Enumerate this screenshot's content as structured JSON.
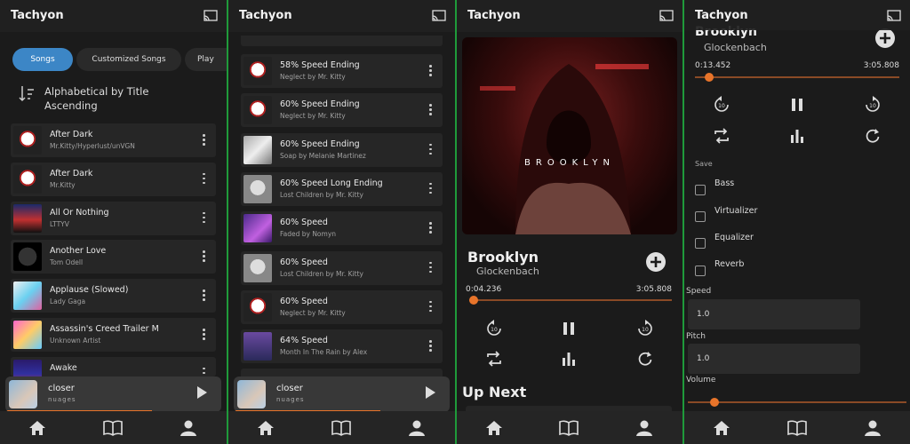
{
  "app": {
    "title": "Tachyon"
  },
  "screen1": {
    "tabs": [
      "Songs",
      "Customized Songs",
      "Play"
    ],
    "sort": {
      "line1": "Alphabetical by Title",
      "line2": "Ascending"
    },
    "songs": [
      {
        "title": "After Dark",
        "subtitle": "Mr.Kitty/Hyperlust/unVGN"
      },
      {
        "title": "After Dark",
        "subtitle": "Mr.Kitty"
      },
      {
        "title": "All Or Nothing",
        "subtitle": "LTTYV"
      },
      {
        "title": "Another Love",
        "subtitle": "Tom Odell"
      },
      {
        "title": "Applause (Slowed)",
        "subtitle": "Lady Gaga"
      },
      {
        "title": "Assassin's Creed Trailer M",
        "subtitle": "Unknown Artist"
      },
      {
        "title": "Awake",
        "subtitle": ""
      }
    ]
  },
  "screen2": {
    "songs": [
      {
        "title": "58% Speed Ending",
        "subtitle": "Neglect by Mr. Kitty"
      },
      {
        "title": "60% Speed Ending",
        "subtitle": "Neglect by Mr. Kitty"
      },
      {
        "title": "60% Speed Ending",
        "subtitle": "Soap by Melanie Martinez"
      },
      {
        "title": "60% Speed Long Ending",
        "subtitle": "Lost Children by Mr. Kitty"
      },
      {
        "title": "60% Speed",
        "subtitle": "Faded by Nomyn"
      },
      {
        "title": "60% Speed",
        "subtitle": "Lost Children by Mr. Kitty"
      },
      {
        "title": "60% Speed",
        "subtitle": "Neglect by Mr. Kitty"
      },
      {
        "title": "64% Speed",
        "subtitle": "Month In The Rain by Alex"
      }
    ]
  },
  "mini_player": {
    "title": "closer",
    "subtitle": "nuages",
    "progress": 0.68
  },
  "player": {
    "album_text": "BROOKLYN",
    "title": "Brooklyn",
    "artist": "Glockenbach",
    "elapsed": "0:04.236",
    "duration": "3:05.808",
    "progress": 0.02,
    "up_next": "Up Next"
  },
  "settings_screen": {
    "title": "Brooklyn",
    "artist": "Glockenbach",
    "elapsed": "0:13.452",
    "duration": "3:05.808",
    "progress": 0.07,
    "save_label": "Save",
    "effects": [
      "Bass",
      "Virtualizer",
      "Equalizer",
      "Reverb"
    ],
    "speed_label": "Speed",
    "speed_value": "1.0",
    "pitch_label": "Pitch",
    "pitch_value": "1.0",
    "volume_label": "Volume",
    "volume_level": 0.12
  },
  "colors": {
    "accent": "#e8742a",
    "chip_active": "#3c86c6",
    "separator": "#1f9a3a"
  },
  "icons": [
    "cast-icon",
    "home-icon",
    "library-icon",
    "profile-icon",
    "kebab-menu-icon",
    "play-icon",
    "pause-icon",
    "replay-10-icon",
    "forward-10-icon",
    "repeat-icon",
    "equalizer-icon",
    "loop-icon",
    "add-playlist-icon",
    "sort-icon"
  ]
}
